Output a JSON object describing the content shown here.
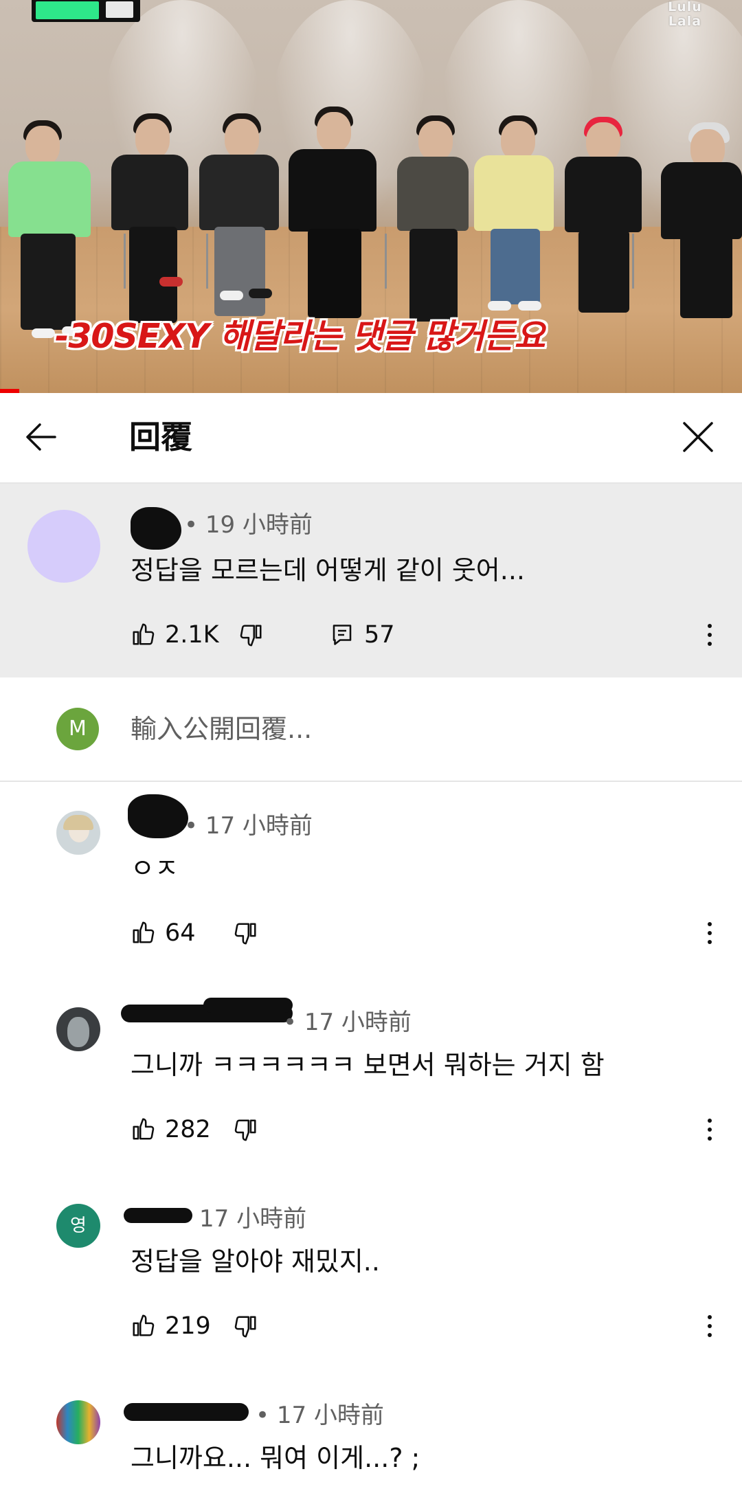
{
  "video": {
    "subtitle": "-30SEXY 해달라는 댓글 많거든요",
    "watermark": "Lulu\nLala"
  },
  "header": {
    "title": "回覆"
  },
  "parent_comment": {
    "meta": "• 19 小時前",
    "text": "정답을 모르는데 어떻게 같이 웃어...",
    "likes": "2.1K",
    "replies": "57",
    "avatar_color": "#d6ccfb"
  },
  "reply_input": {
    "placeholder": "輸入公開回覆...",
    "avatar_letter": "M",
    "avatar_color": "#6ba53d"
  },
  "replies": [
    {
      "meta": "• 17 小時前",
      "text": "ㅇㅈ",
      "likes": "64"
    },
    {
      "meta": "• 17 小時前",
      "text": "그니까 ㅋㅋㅋㅋㅋㅋ 보면서 뭐하는 거지 함",
      "likes": "282"
    },
    {
      "meta": "17 小時前",
      "text": "정답을 알아야 재밌지..",
      "likes": "219",
      "avatar_letter": "영",
      "avatar_color": "#1e8a6d"
    },
    {
      "meta": "• 17 小時前",
      "text": "그니까요... 뭐여 이게...? ;"
    }
  ],
  "colors": {
    "accent_red": "#d81717",
    "text_primary": "#0f0f0f",
    "text_secondary": "#606060",
    "highlight_bg": "#ececec"
  }
}
